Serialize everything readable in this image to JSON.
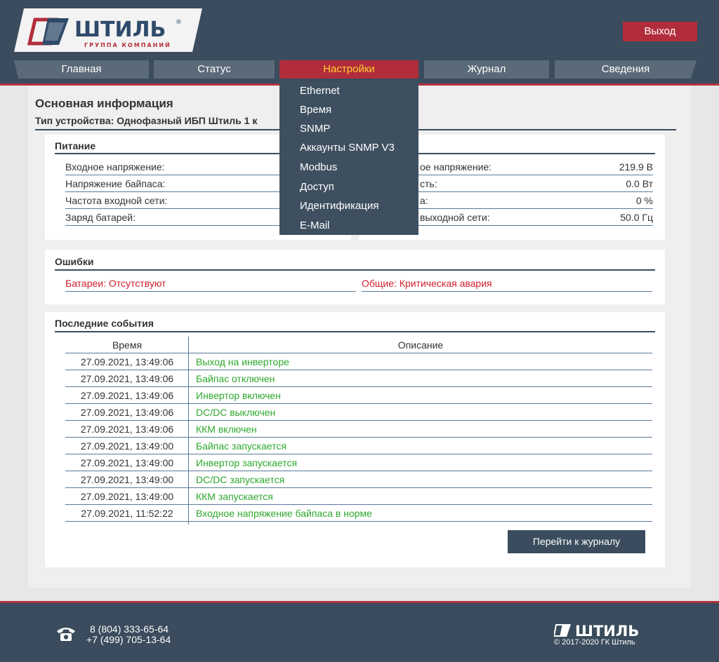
{
  "header": {
    "logo_text": "ШТИЛЬ",
    "logo_subtitle": "ГРУППА КОМПАНИЙ",
    "logout_label": "Выход"
  },
  "nav": {
    "items": [
      {
        "label": "Главная"
      },
      {
        "label": "Статус"
      },
      {
        "label": "Настройки"
      },
      {
        "label": "Журнал"
      },
      {
        "label": "Сведения"
      }
    ]
  },
  "dropdown": {
    "items": [
      "Ethernet",
      "Время",
      "SNMP",
      "Аккаунты SNMP V3",
      "Modbus",
      "Доступ",
      "Идентификация",
      "E-Mail"
    ]
  },
  "page": {
    "title": "Основная информация",
    "device_type": "Тип устройства: Однофазный ИБП Штиль 1 к"
  },
  "power": {
    "title": "Питание",
    "left": [
      {
        "label": "Входное напряжение:"
      },
      {
        "label": "Напряжение байпаса:"
      },
      {
        "label": "Частота входной сети:"
      },
      {
        "label": "Заряд батарей:"
      }
    ],
    "right": [
      {
        "label": "ое напряжение:",
        "value": "219.9 В"
      },
      {
        "label": "сть:",
        "value": "0.0 Вт"
      },
      {
        "label": "а:",
        "value": "0 %"
      },
      {
        "label": "выходной сети:",
        "value": "50.0 Гц"
      }
    ]
  },
  "errors": {
    "title": "Ошибки",
    "items": [
      "Батареи: Отсутствуют",
      "Общие: Критическая авария"
    ]
  },
  "events": {
    "title": "Последние события",
    "col_time": "Время",
    "col_desc": "Описание",
    "rows": [
      {
        "time": "27.09.2021, 13:49:06",
        "desc": "Выход на инверторе"
      },
      {
        "time": "27.09.2021, 13:49:06",
        "desc": "Байпас отключен"
      },
      {
        "time": "27.09.2021, 13:49:06",
        "desc": "Инвертор включен"
      },
      {
        "time": "27.09.2021, 13:49:06",
        "desc": "DC/DC выключен"
      },
      {
        "time": "27.09.2021, 13:49:06",
        "desc": "ККМ включен"
      },
      {
        "time": "27.09.2021, 13:49:00",
        "desc": "Байпас запускается"
      },
      {
        "time": "27.09.2021, 13:49:00",
        "desc": "Инвертор запускается"
      },
      {
        "time": "27.09.2021, 13:49:00",
        "desc": "DC/DC запускается"
      },
      {
        "time": "27.09.2021, 13:49:00",
        "desc": "ККМ запускается"
      },
      {
        "time": "27.09.2021, 11:52:22",
        "desc": "Входное напряжение байпаса в норме"
      }
    ],
    "button_label": "Перейти к журналу"
  },
  "footer": {
    "phone1": "8 (804) 333-65-64",
    "phone2": "+7 (499) 705-13-64",
    "logo_text": "ШТИЛЬ",
    "copyright": "© 2017-2020 ГК Штиль"
  },
  "colors": {
    "header_bg": "#3a4c5d",
    "accent_red": "#b22d3b",
    "active_text": "#ffcc33",
    "error_red": "#d0202c",
    "event_green": "#2ea82e"
  }
}
